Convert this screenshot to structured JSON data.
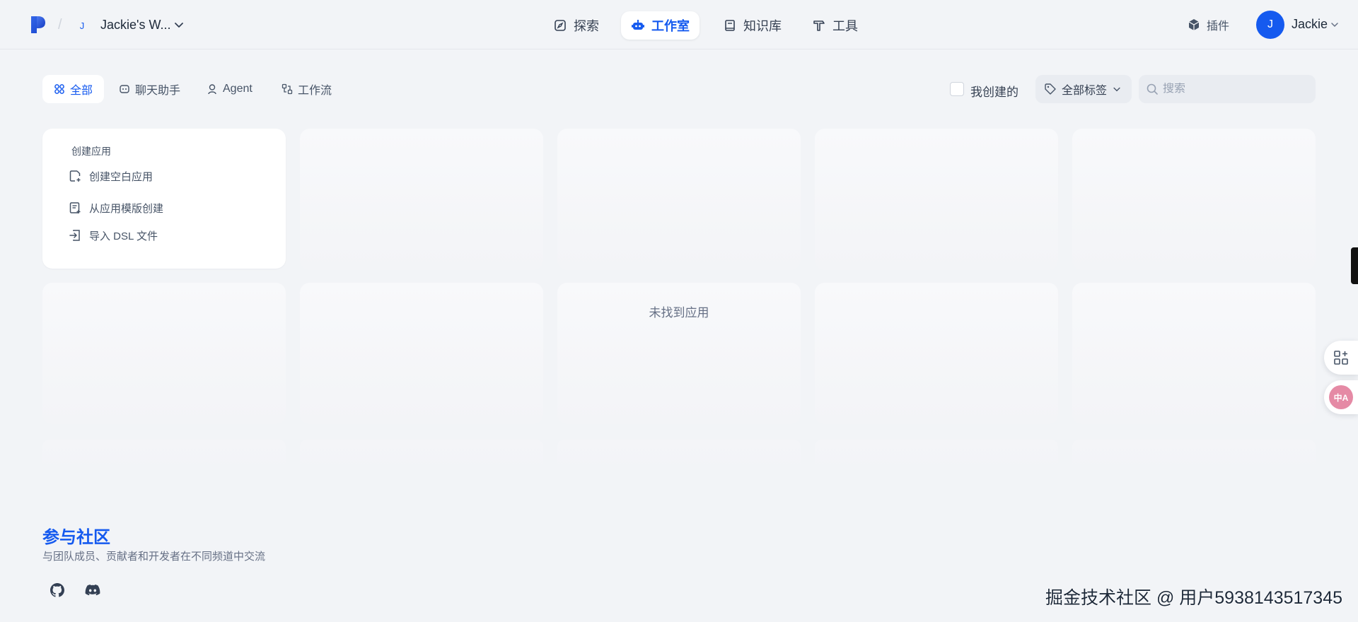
{
  "header": {
    "workspace_initial": "J",
    "workspace_name": "Jackie's W...",
    "nav": [
      {
        "label": "探索",
        "icon": "compass-icon"
      },
      {
        "label": "工作室",
        "icon": "robot-icon",
        "active": true
      },
      {
        "label": "知识库",
        "icon": "book-icon"
      },
      {
        "label": "工具",
        "icon": "hammer-icon"
      }
    ],
    "plugin_label": "插件",
    "user_initial": "J",
    "user_name": "Jackie"
  },
  "filters": {
    "tabs": [
      {
        "label": "全部",
        "icon": "grid-icon",
        "active": true
      },
      {
        "label": "聊天助手",
        "icon": "chat-bot-icon"
      },
      {
        "label": "Agent",
        "icon": "agent-icon"
      },
      {
        "label": "工作流",
        "icon": "workflow-icon"
      }
    ],
    "created_by_me_label": "我创建的",
    "tag_filter_label": "全部标签",
    "search_placeholder": "搜索"
  },
  "create_card": {
    "title": "创建应用",
    "items": [
      {
        "label": "创建空白应用",
        "icon": "new-file-icon"
      },
      {
        "label": "从应用模版创建",
        "icon": "template-icon"
      },
      {
        "label": "导入 DSL 文件",
        "icon": "import-icon"
      }
    ]
  },
  "empty_state": "未找到应用",
  "community": {
    "title": "参与社区",
    "subtitle": "与团队成员、贡献者和开发者在不同频道中交流",
    "links": [
      {
        "icon": "github-icon"
      },
      {
        "icon": "discord-icon"
      }
    ]
  },
  "watermark": "掘金技术社区 @ 用户5938143517345",
  "colors": {
    "accent": "#155aef",
    "background": "#f2f4f7",
    "card": "#ffffff"
  }
}
